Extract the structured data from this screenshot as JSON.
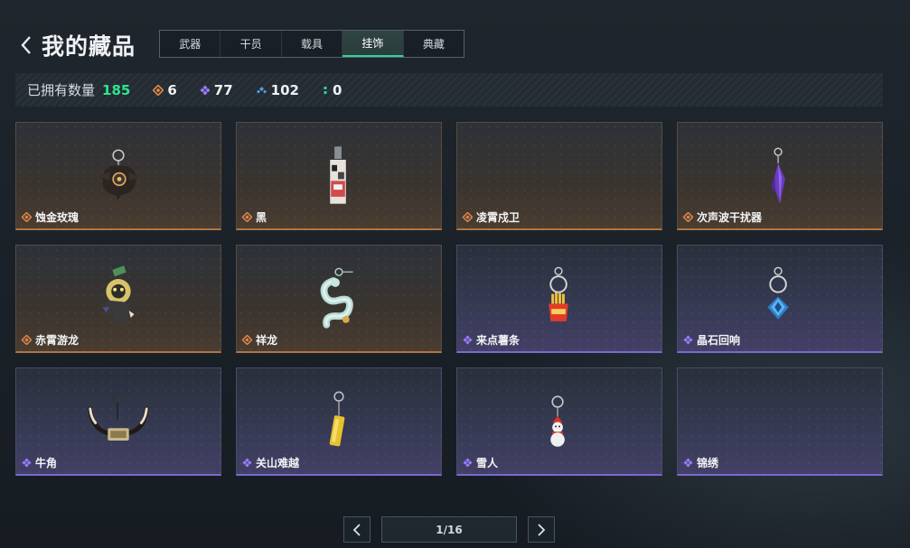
{
  "header": {
    "title": "我的藏品"
  },
  "tabs": [
    {
      "label": "武器",
      "active": false
    },
    {
      "label": "干员",
      "active": false
    },
    {
      "label": "载具",
      "active": false
    },
    {
      "label": "挂饰",
      "active": true
    },
    {
      "label": "典藏",
      "active": false
    }
  ],
  "stats": {
    "owned_label": "已拥有数量",
    "owned_count": "185",
    "orange_count": "6",
    "purple_count": "77",
    "blue_count": "102",
    "green_count": "0"
  },
  "colors": {
    "accent_green": "#2ee58f",
    "rarity_orange": "#e0874a",
    "rarity_purple": "#9b7bff",
    "rarity_blue": "#4f9fe6"
  },
  "items": [
    {
      "name": "蚀金玫瑰",
      "rarity": "orange",
      "icon": "black-rose-charm-icon"
    },
    {
      "name": "黑",
      "rarity": "orange",
      "icon": "card-tag-charm-icon"
    },
    {
      "name": "凌霄戍卫",
      "rarity": "orange",
      "icon": "empty-charm-icon"
    },
    {
      "name": "次声波干扰器",
      "rarity": "orange",
      "icon": "purple-crystal-charm-icon"
    },
    {
      "name": "赤霄游龙",
      "rarity": "orange",
      "icon": "gold-dragon-charm-icon"
    },
    {
      "name": "祥龙",
      "rarity": "orange",
      "icon": "jade-dragon-charm-icon"
    },
    {
      "name": "来点薯条",
      "rarity": "purple",
      "icon": "fries-charm-icon"
    },
    {
      "name": "晶石回响",
      "rarity": "purple",
      "icon": "blue-gem-charm-icon"
    },
    {
      "name": "牛角",
      "rarity": "purple",
      "icon": "bull-horn-charm-icon"
    },
    {
      "name": "关山难越",
      "rarity": "purple",
      "icon": "gold-bar-charm-icon"
    },
    {
      "name": "雪人",
      "rarity": "purple",
      "icon": "snowman-charm-icon"
    },
    {
      "name": "锦绣",
      "rarity": "purple",
      "icon": "empty-charm-icon"
    }
  ],
  "pagination": {
    "label": "1/16"
  }
}
